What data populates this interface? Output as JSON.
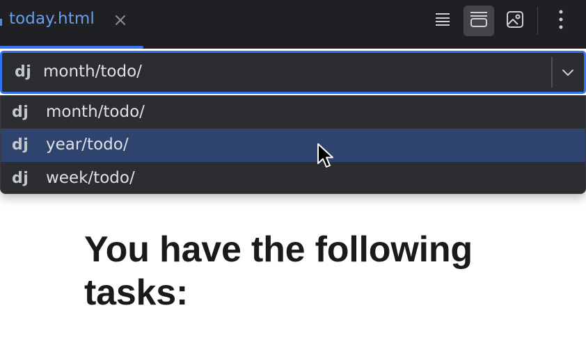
{
  "tab": {
    "label": "today.html",
    "close_icon": "close-icon"
  },
  "toolbar": {
    "buttons": [
      {
        "name": "source-view-icon",
        "active": false
      },
      {
        "name": "split-view-icon",
        "active": true
      },
      {
        "name": "preview-view-icon",
        "active": false
      },
      {
        "name": "more-options-icon",
        "active": false
      }
    ]
  },
  "combo": {
    "badge": "dj",
    "value": "month/todo/",
    "arrow_icon": "chevron-down-icon"
  },
  "dropdown": {
    "options": [
      {
        "badge": "dj",
        "label": "month/todo/",
        "selected": false
      },
      {
        "badge": "dj",
        "label": "year/todo/",
        "selected": true
      },
      {
        "badge": "dj",
        "label": "week/todo/",
        "selected": false
      }
    ]
  },
  "preview": {
    "heading": "You have the following tasks:"
  },
  "colors": {
    "accent": "#3574f0",
    "selection": "#2e436e",
    "panel": "#2b2d30",
    "tab_label": "#6b9ee8"
  }
}
